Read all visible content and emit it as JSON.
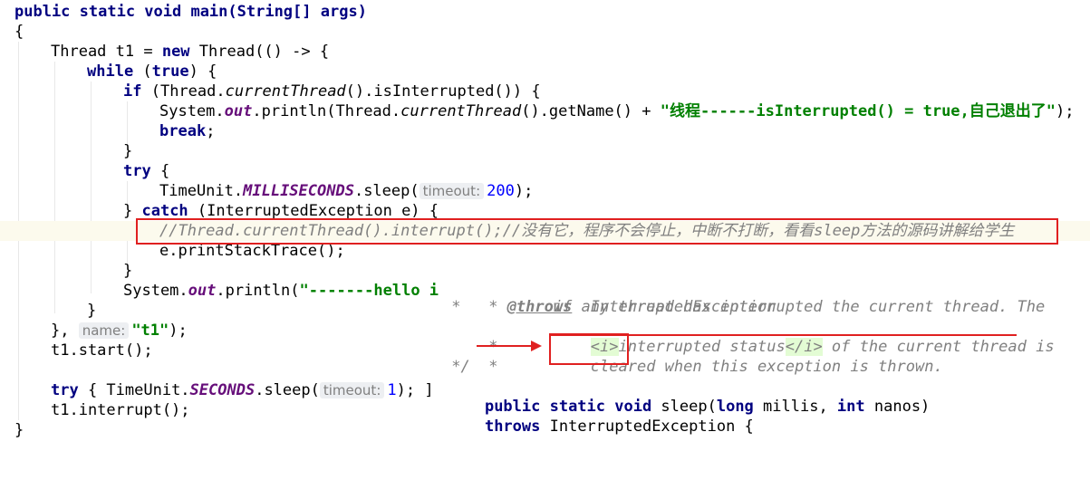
{
  "editor": {
    "l01": "public static void main(String[] args)",
    "l02": "{",
    "l03_a": "Thread t1 = ",
    "l03_kw": "new",
    "l03_b": " Thread(() -> {",
    "l04_kw": "while",
    "l04_a": " (",
    "l04_kw2": "true",
    "l04_b": ") {",
    "l05_kw": "if",
    "l05_a": " (Thread.",
    "l05_i": "currentThread",
    "l05_b": "().isInterrupted()) {",
    "l06_a": "System.",
    "l06_f": "out",
    "l06_b": ".println(Thread.",
    "l06_i": "currentThread",
    "l06_c": "().getName() + ",
    "l06_s": "\"线程------isInterrupted() = true,自己退出了\"",
    "l06_d": ");",
    "l07_kw": "break",
    "l07_a": ";",
    "l08": "}",
    "l09_kw": "try",
    "l09_a": " {",
    "l10_a": "TimeUnit.",
    "l10_f": "MILLISECONDS",
    "l10_b": ".sleep(",
    "l10_hint": "timeout:",
    "l10_n": "200",
    "l10_c": ");",
    "l11_a": "} ",
    "l11_kw": "catch",
    "l11_b": " (InterruptedException e) {",
    "l12_cmt": "//Thread.currentThread().interrupt();//没有它，程序不会停止，中断不打断，看看sleep方法的源码讲解给学生",
    "l13": "e.printStackTrace();",
    "l14": "}",
    "l15_a": "System.",
    "l15_f": "out",
    "l15_b": ".println(",
    "l15_s": "\"-------hello i",
    "l16": "}",
    "l17_a": "}, ",
    "l17_hint": "name:",
    "l17_s": "\"t1\"",
    "l17_b": ");",
    "l18": "t1.start();",
    "l20_kw": "try",
    "l20_a": " { TimeUnit.",
    "l20_f": "SECONDS",
    "l20_b": ".sleep(",
    "l20_hint": "timeout:",
    "l20_n": "1",
    "l20_c": "); ]",
    "l21": "t1.interrupt();",
    "l22": "}"
  },
  "popup": {
    "p1_star": " * ",
    "p1_tag": "@throws",
    "p1_exc": "  InterruptedException",
    "p2": " *          if any thread has interrupted the current thread. The",
    "p3_a": " *          ",
    "p3_open": "<i>",
    "p3_b": "interrupted status",
    "p3_close": "</i>",
    "p3_c": " of the current thread is",
    "p4_a": " *          ",
    "p4_b": "cleared",
    "p4_c": " when this exception is thrown.",
    "p5": " */",
    "p6_kw1": "public static void",
    "p6_a": " sleep(",
    "p6_kw2": "long",
    "p6_b": " millis, ",
    "p6_kw3": "int",
    "p6_c": " nanos)",
    "p7_kw": "throws",
    "p7_a": " InterruptedException {"
  },
  "colors": {
    "keyword": "#000080",
    "string": "#008000",
    "field": "#660e7a",
    "comment": "#808080",
    "number": "#0000ff",
    "annotation_red": "#e02020"
  }
}
